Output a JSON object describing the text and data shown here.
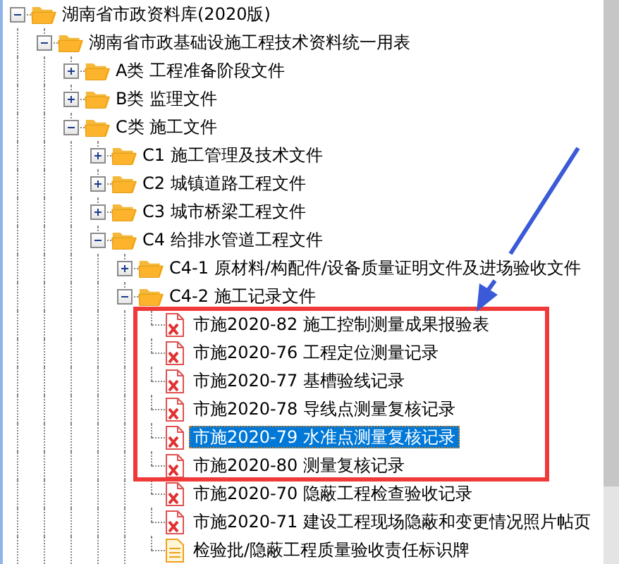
{
  "tree": {
    "items": [
      {
        "kind": "folder",
        "label": "湖南省市政资料库(2020版)",
        "expanded": true,
        "children": [
          {
            "kind": "folder",
            "label": "湖南省市政基础设施工程技术资料统一用表",
            "expanded": true,
            "children": [
              {
                "kind": "folder",
                "label": "A类 工程准备阶段文件",
                "expanded": false
              },
              {
                "kind": "folder",
                "label": "B类 监理文件",
                "expanded": false
              },
              {
                "kind": "folder",
                "label": "C类 施工文件",
                "expanded": true,
                "children": [
                  {
                    "kind": "folder",
                    "label": "C1 施工管理及技术文件",
                    "expanded": false
                  },
                  {
                    "kind": "folder",
                    "label": "C2 城镇道路工程文件",
                    "expanded": false
                  },
                  {
                    "kind": "folder",
                    "label": "C3 城市桥梁工程文件",
                    "expanded": false
                  },
                  {
                    "kind": "folder",
                    "label": "C4 给排水管道工程文件",
                    "expanded": true,
                    "children": [
                      {
                        "kind": "folder",
                        "label": "C4-1 原材料/构配件/设备质量证明文件及进场验收文件",
                        "expanded": false
                      },
                      {
                        "kind": "folder",
                        "label": "C4-2 施工记录文件",
                        "expanded": true,
                        "children": [
                          {
                            "kind": "form",
                            "label": "市施2020-82 施工控制测量成果报验表",
                            "selected": false
                          },
                          {
                            "kind": "form",
                            "label": "市施2020-76 工程定位测量记录",
                            "selected": false
                          },
                          {
                            "kind": "form",
                            "label": "市施2020-77 基槽验线记录",
                            "selected": false
                          },
                          {
                            "kind": "form",
                            "label": "市施2020-78 导线点测量复核记录",
                            "selected": false
                          },
                          {
                            "kind": "form",
                            "label": "市施2020-79 水准点测量复核记录",
                            "selected": true
                          },
                          {
                            "kind": "form",
                            "label": "市施2020-80 测量复核记录",
                            "selected": false
                          },
                          {
                            "kind": "form",
                            "label": "市施2020-70 隐蔽工程检查验收记录",
                            "selected": false
                          },
                          {
                            "kind": "form",
                            "label": "市施2020-71 建设工程现场隐蔽和变更情况照片帖页",
                            "selected": false
                          },
                          {
                            "kind": "note",
                            "label": "检验批/隐蔽工程质量验收责任标识牌",
                            "selected": false
                          }
                        ]
                      }
                    ]
                  }
                ]
              }
            ]
          }
        ]
      }
    ]
  }
}
